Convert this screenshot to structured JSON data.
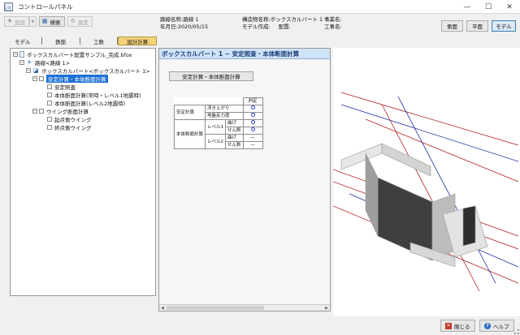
{
  "window": {
    "title": "コントロールパネル",
    "minimize": "—",
    "maximize": "☐",
    "close": "✕"
  },
  "toolbar": {
    "add_label": "追加",
    "search_label": "検索",
    "settings_label": "設定"
  },
  "info": {
    "route_name": "路線名称:路線 1",
    "date": "年月日:2020/05/15",
    "structure_name": "構造物名称:ボックスカルバート 1",
    "model_author": "モデル作成:",
    "placement": "配置:",
    "project_name": "事業名:",
    "construction_name": "工事名:"
  },
  "view_buttons": {
    "side": "側面",
    "plan": "平面",
    "model": "モデル",
    "active": "モデル"
  },
  "tabs": [
    "モデル",
    "鉄筋",
    "工数",
    "設計計算"
  ],
  "active_tab": "設計計算",
  "tree": {
    "file": "ボックスカルバート配置サンプル_完成.bfox",
    "route": "路線<路線 1>",
    "culvert": "ボックスカルバート<ボックスカルバート 1>",
    "calc_selected": "安定計算・本体断面計算",
    "stability": "安定照査",
    "body_normal": "本体断面計算(常時・レベル1地震時)",
    "body_level2": "本体断面計算(レベル2地震時)",
    "wing": "ウイング断面計算",
    "wing_start": "起点側ウイング",
    "wing_end": "終点側ウイング"
  },
  "document": {
    "header": "ボックスカルバート 1 − 安定照査・本体断面計算",
    "section_button": "安定計算・本体断面計算",
    "table": {
      "judgement_header": "判定",
      "stability_group": "安定計算",
      "uplift": "浮き上がり",
      "bearing": "地盤反力度",
      "body_group": "本体断面計算",
      "level1": "レベル1",
      "level2": "レベル2",
      "bending": "曲げ",
      "shear": "せん断",
      "dash": "—"
    }
  },
  "bottom": {
    "close_label": "閉じる",
    "help_label": "ヘルプ"
  },
  "colors": {
    "selection": "#1c6fd4",
    "active_tab": "#f3d27a",
    "doc_header": "#cfe3f7"
  },
  "icons": [
    "app-window-icon",
    "add-icon",
    "search-icon",
    "settings-icon",
    "file-icon",
    "route-icon",
    "culvert-icon",
    "close-icon",
    "help-icon"
  ]
}
